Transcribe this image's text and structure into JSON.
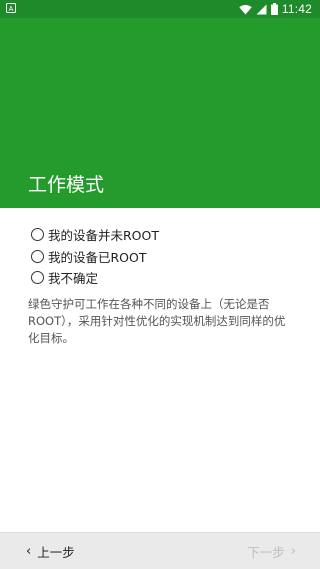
{
  "status_bar": {
    "time": "11:42",
    "icons": [
      "notification-a-icon",
      "wifi-icon",
      "signal-icon",
      "battery-icon"
    ]
  },
  "header": {
    "title": "工作模式"
  },
  "options": [
    {
      "label": "我的设备并未ROOT",
      "selected": false
    },
    {
      "label": "我的设备已ROOT",
      "selected": false
    },
    {
      "label": "我不确定",
      "selected": false
    }
  ],
  "description": "绿色守护可工作在各种不同的设备上（无论是否ROOT），采用针对性优化的实现机制达到同样的优化目标。",
  "bottom_nav": {
    "prev_label": "上一步",
    "next_label": "下一步",
    "next_enabled": false
  },
  "colors": {
    "status_bar": "#1f8a2a",
    "header": "#259a2d",
    "bottom_bar": "#eaeaea",
    "disabled_text": "#bdbdbd"
  }
}
